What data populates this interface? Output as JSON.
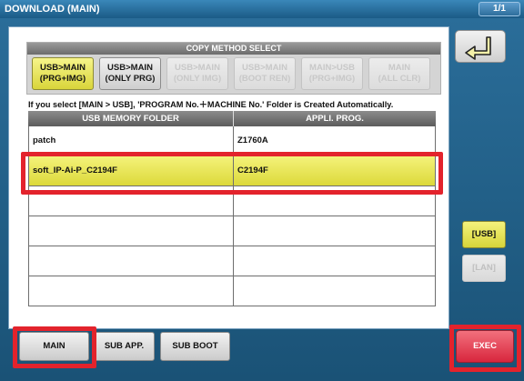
{
  "window": {
    "title": "DOWNLOAD (MAIN)",
    "page": "1/1"
  },
  "copy_method": {
    "header": "COPY METHOD SELECT",
    "buttons": [
      {
        "line1": "USB>MAIN",
        "line2": "(PRG+IMG)",
        "state": "selected"
      },
      {
        "line1": "USB>MAIN",
        "line2": "(ONLY PRG)",
        "state": "enabled"
      },
      {
        "line1": "USB>MAIN",
        "line2": "(ONLY IMG)",
        "state": "disabled"
      },
      {
        "line1": "USB>MAIN",
        "line2": "(BOOT REN)",
        "state": "disabled"
      },
      {
        "line1": "MAIN>USB",
        "line2": "(PRG+IMG)",
        "state": "disabled"
      },
      {
        "line1": "MAIN",
        "line2": "(ALL CLR)",
        "state": "disabled"
      }
    ]
  },
  "note": "If you select [MAIN > USB], 'PROGRAM No.＋MACHINE No.' Folder is Created Automatically.",
  "table": {
    "columns": [
      "USB MEMORY FOLDER",
      "APPLI. PROG."
    ],
    "rows": [
      [
        "patch",
        "Z1760A"
      ],
      [
        "soft_IP-Ai-P_C2194F",
        "C2194F"
      ],
      [
        "",
        ""
      ],
      [
        "",
        ""
      ],
      [
        "",
        ""
      ],
      [
        "",
        ""
      ]
    ],
    "selected_row": 1
  },
  "side": {
    "usb_label": "[USB]",
    "lan_label": "[LAN]"
  },
  "tabs": {
    "main": "MAIN",
    "sub_app": "SUB APP.",
    "sub_boot": "SUB BOOT"
  },
  "exec_label": "EXEC",
  "colors": {
    "selected": "#e6e350",
    "highlight_frame": "#e3232c",
    "exec": "#e23a4e"
  },
  "icons": {
    "back": "return-arrow-icon"
  }
}
